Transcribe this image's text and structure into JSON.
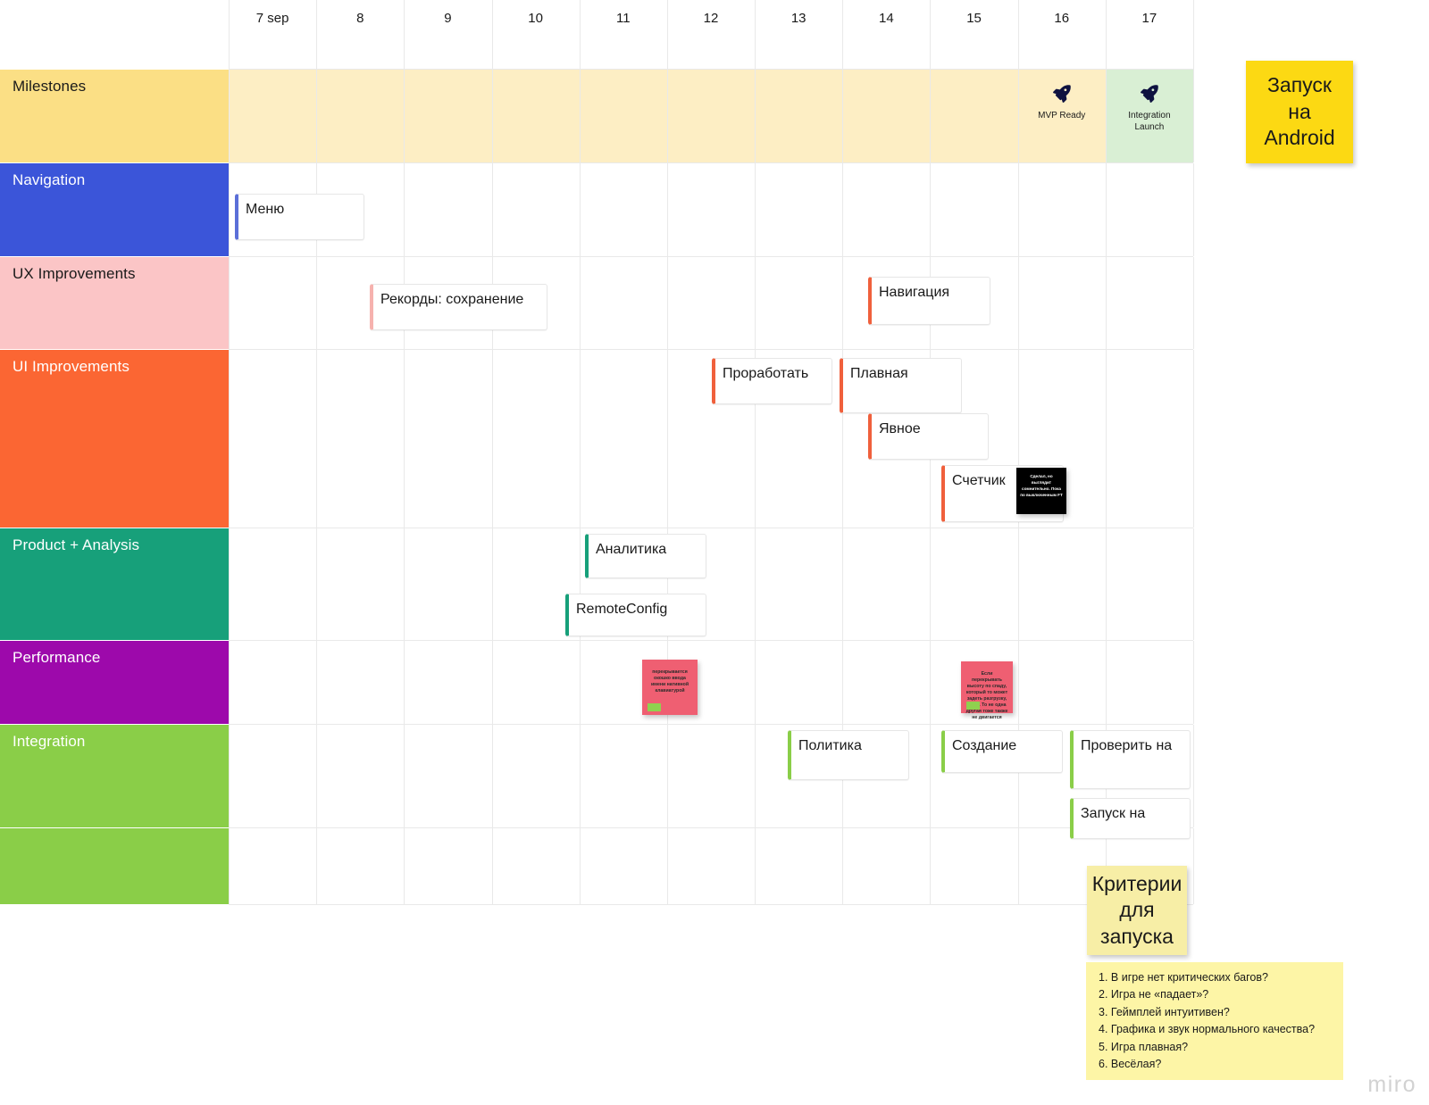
{
  "board": {
    "watermark": "miro"
  },
  "timeline": {
    "corner_label": "",
    "dates": [
      "7 sep",
      "8",
      "9",
      "10",
      "11",
      "12",
      "13",
      "14",
      "15",
      "16",
      "17"
    ]
  },
  "rows": [
    {
      "label": "Milestones",
      "bg": "#fbdf85",
      "text_color": "#1a1a1a"
    },
    {
      "label": "Navigation",
      "bg": "#3b55d9",
      "text_color": "#ffffff"
    },
    {
      "label": "UX Improvements",
      "bg": "#fbc5c6",
      "text_color": "#1a1a1a"
    },
    {
      "label": "UI Improvements",
      "bg": "#fb6633",
      "text_color": "#ffffff"
    },
    {
      "label": "Product + Analysis",
      "bg": "#17a07a",
      "text_color": "#ffffff"
    },
    {
      "label": "Performance",
      "bg": "#9d09ab",
      "text_color": "#ffffff"
    },
    {
      "label": "Integration",
      "bg": "#8ace48",
      "text_color": "#ffffff"
    },
    {
      "label": "",
      "bg": "#8ace48",
      "text_color": "#ffffff"
    }
  ],
  "milestone_band": {
    "fill_default": "#fdeec4",
    "fill_highlight": "#d9efd4",
    "highlight_date": "17",
    "markers": [
      {
        "date": "16",
        "label": "MVP Ready",
        "icon": "rocket-icon"
      },
      {
        "date": "17",
        "label": "Integration\nLaunch",
        "icon": "rocket-icon"
      }
    ]
  },
  "cards": [
    {
      "id": "menu",
      "row": "Navigation",
      "label": "Меню",
      "accent": "#5b6fd8"
    },
    {
      "id": "records",
      "row": "UX Improvements",
      "label": "Рекорды: сохранение",
      "accent": "#f6b2ae"
    },
    {
      "id": "navigation",
      "row": "UX Improvements",
      "label": "Навигация",
      "accent": "#f0603c"
    },
    {
      "id": "prorabotat",
      "row": "UI Improvements",
      "label": "Проработать",
      "accent": "#f0603c"
    },
    {
      "id": "plavnaya",
      "row": "UI Improvements",
      "label": "Плавная",
      "accent": "#f0603c"
    },
    {
      "id": "yavnoe",
      "row": "UI Improvements",
      "label": "Явное",
      "accent": "#f0603c"
    },
    {
      "id": "schetchik",
      "row": "UI Improvements",
      "label": "Счетчик",
      "accent": "#f0603c"
    },
    {
      "id": "analitika",
      "row": "Product + Analysis",
      "label": "Аналитика",
      "accent": "#17a07a"
    },
    {
      "id": "remoteconfig",
      "row": "Product + Analysis",
      "label": "RemoteConfig",
      "accent": "#17a07a"
    },
    {
      "id": "politika",
      "row": "Integration",
      "label": "Политика",
      "accent": "#8ace48"
    },
    {
      "id": "sozdanie",
      "row": "Integration",
      "label": "Создание",
      "accent": "#8ace48"
    },
    {
      "id": "proverit",
      "row": "Integration",
      "label": "Проверить на",
      "accent": "#8ace48"
    },
    {
      "id": "zapusk_na",
      "row": "Integration",
      "label": "Запуск на",
      "accent": "#8ace48"
    }
  ],
  "sticky_notes": [
    {
      "id": "android-launch",
      "text": "Запуск\nна\nAndroid",
      "color": "#fcd913"
    },
    {
      "id": "criteria-title",
      "text": "Критерии\nдля\nзапуска",
      "color": "#f7eea6"
    },
    {
      "id": "keyboard-overlap",
      "text": "перекрывается окошко ввода имени нативной клавиатурой",
      "color": "#ef5f72",
      "tag_color": "#8fd14f"
    },
    {
      "id": "speed-note",
      "text": "Если перекрывать высоту по спаду, который то может задеть разгрузку, ниже. То не одна другая тоже также не двигается",
      "color": "#ef5f72",
      "tag_color": "#8fd14f"
    },
    {
      "id": "counter-comment",
      "text": "Сделал, но выглядит сомнительно. Пока по выключенным FT",
      "color": "#000000"
    }
  ],
  "criteria": {
    "bg": "#fdf5a6",
    "items": [
      "1. В игре нет критических багов?",
      "2. Игра не «падает»?",
      "3. Геймплей интуитивен?",
      "4. Графика и звук нормального качества?",
      "5. Игра плавная?",
      "6. Весёлая?"
    ]
  }
}
